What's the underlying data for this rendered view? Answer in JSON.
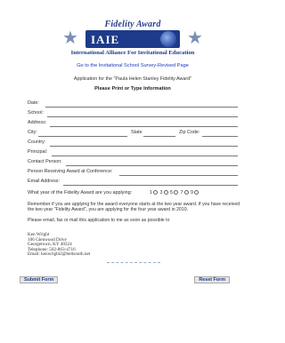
{
  "logo": {
    "title": "Fidelity Award",
    "band_text": "IAIE",
    "tagline": "International Alliance For Invitational Education"
  },
  "link_text": "Go to the Invitational School Survey-Revised Page",
  "subtitle": "Application for the \"Paula Helen Stanley Fidelity Award\"",
  "print_instruction": "Please Print or Type Information",
  "fields": {
    "date": "Date:",
    "school": "School:",
    "address": "Address:",
    "city": "City:",
    "state": "State",
    "zip": "Zip Code:",
    "country": "Country:",
    "principal": "Principal:",
    "contact": "Contact Person:",
    "receiving": "Person Receiving Award at Conference:",
    "email": "Email Address:"
  },
  "year_question": "What year of the Fidelity Award are you applying:",
  "year_options": [
    "1",
    "3",
    "5",
    "7",
    "9"
  ],
  "remember_text": "Remember if you are applying for the award everyone starts at the two year award. If you have received the two year \"Fidelity Award\", you are applying for the four year award in 2010.",
  "mail_text": "Please email, fax or mail this application to me as soon as possible to",
  "address": {
    "name": "Ken Wright",
    "street": "106 Glenwood Drive",
    "city": "Georgetown, KY 40324",
    "phone": "Telephone: 502-863-4716",
    "email": "Email: kenwright2@bellsouth.net"
  },
  "buttons": {
    "submit": "Submit Form",
    "reset": "Reset Form"
  }
}
